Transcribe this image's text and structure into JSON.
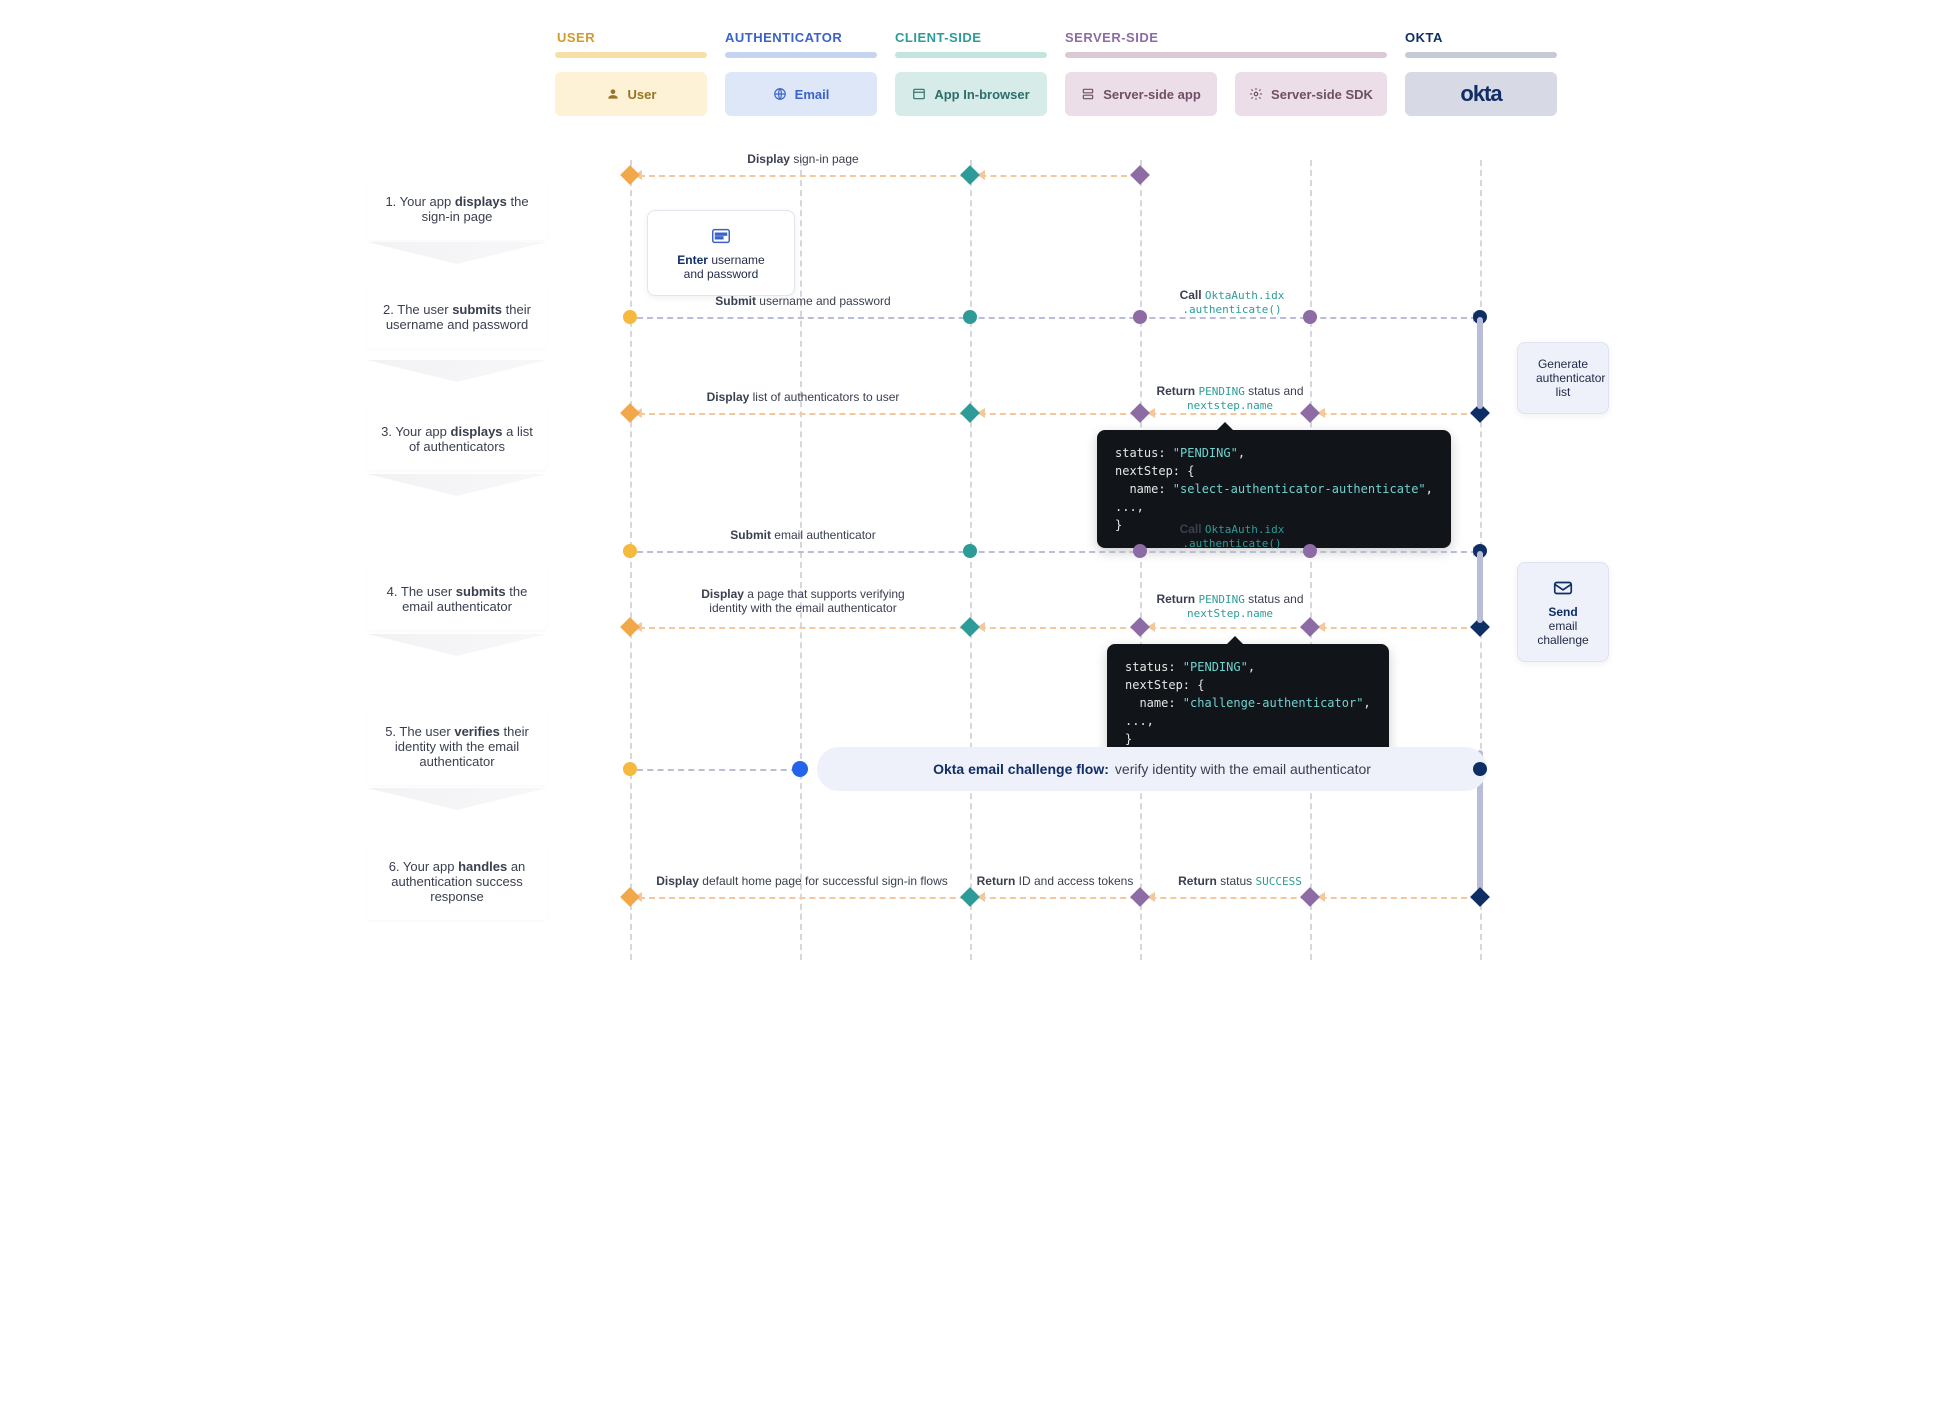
{
  "headers": {
    "user": "USER",
    "authenticator": "AUTHENTICATOR",
    "clientside": "CLIENT-SIDE",
    "serverside": "SERVER-SIDE",
    "okta": "OKTA"
  },
  "lanes": {
    "user": "User",
    "email": "Email",
    "app": "App In-browser",
    "server_app": "Server-side app",
    "server_sdk": "Server-side SDK",
    "okta": "okta"
  },
  "steps": {
    "s1a": "1. Your app ",
    "s1b": "displays",
    "s1c": " the sign-in page",
    "s2a": "2. The user ",
    "s2b": "submits",
    "s2c": " their username and password",
    "s3a": "3. Your app ",
    "s3b": "displays",
    "s3c": " a list of authenticators",
    "s4a": "4. The user ",
    "s4b": "submits",
    "s4c": " the email authenticator",
    "s5a": "5. The user ",
    "s5b": "verifies",
    "s5c": " their identity with the email authenticator",
    "s6a": "6. Your app ",
    "s6b": "handles",
    "s6c": " an authentication success response"
  },
  "labels": {
    "l1_display": "Display",
    "l1_text": " sign-in page",
    "enter_b": "Enter",
    "enter_t": " username and password",
    "l2_submit": "Submit",
    "l2_text": " username and password",
    "l2_call": "Call ",
    "l2_code": "OktaAuth.idx .authenticate()",
    "gen_list": "Generate authenticator list",
    "l3_display": "Display",
    "l3_text": " list of authenticators to user",
    "l3_return": "Return ",
    "l3_code1": "PENDING",
    "l3_mid": " status and ",
    "l3_code2": "nextstep.name",
    "l4_submit": "Submit",
    "l4_text": " email authenticator",
    "l4_call": "Call ",
    "l4_code": "OktaAuth.idx .authenticate()",
    "l5_display": "Display",
    "l5_text": " a page that supports verifying identity with the email authenticator",
    "l5_return": "Return ",
    "l5_code1": "PENDING",
    "l5_mid": " status and ",
    "l5_code2": "nextStep.name",
    "send_b": "Send",
    "send_t": " email challenge",
    "band_b": "Okta email challenge flow:",
    "band_t": "  verify identity with the email authenticator",
    "l6_display": "Display",
    "l6_text": " default home page for successful sign-in flows",
    "l6_ret1": "Return",
    "l6_ret1t": " ID and access tokens",
    "l6_ret2": "Return",
    "l6_ret2t": " status ",
    "l6_ret2c": "SUCCESS"
  },
  "code1": {
    "l1": "status: ",
    "l1s": "\"PENDING\"",
    "l1e": ",",
    "l2": "nextStep: {",
    "l3": "  name: ",
    "l3s": "\"select-authenticator-authenticate\"",
    "l3e": ",",
    "l4": "...,",
    "l5": "}"
  },
  "code2": {
    "l1": "status: ",
    "l1s": "\"PENDING\"",
    "l1e": ",",
    "l2": "nextStep: {",
    "l3": "  name: ",
    "l3s": "\"challenge-authenticator\"",
    "l3e": ",",
    "l4": "...,",
    "l5": "}"
  }
}
